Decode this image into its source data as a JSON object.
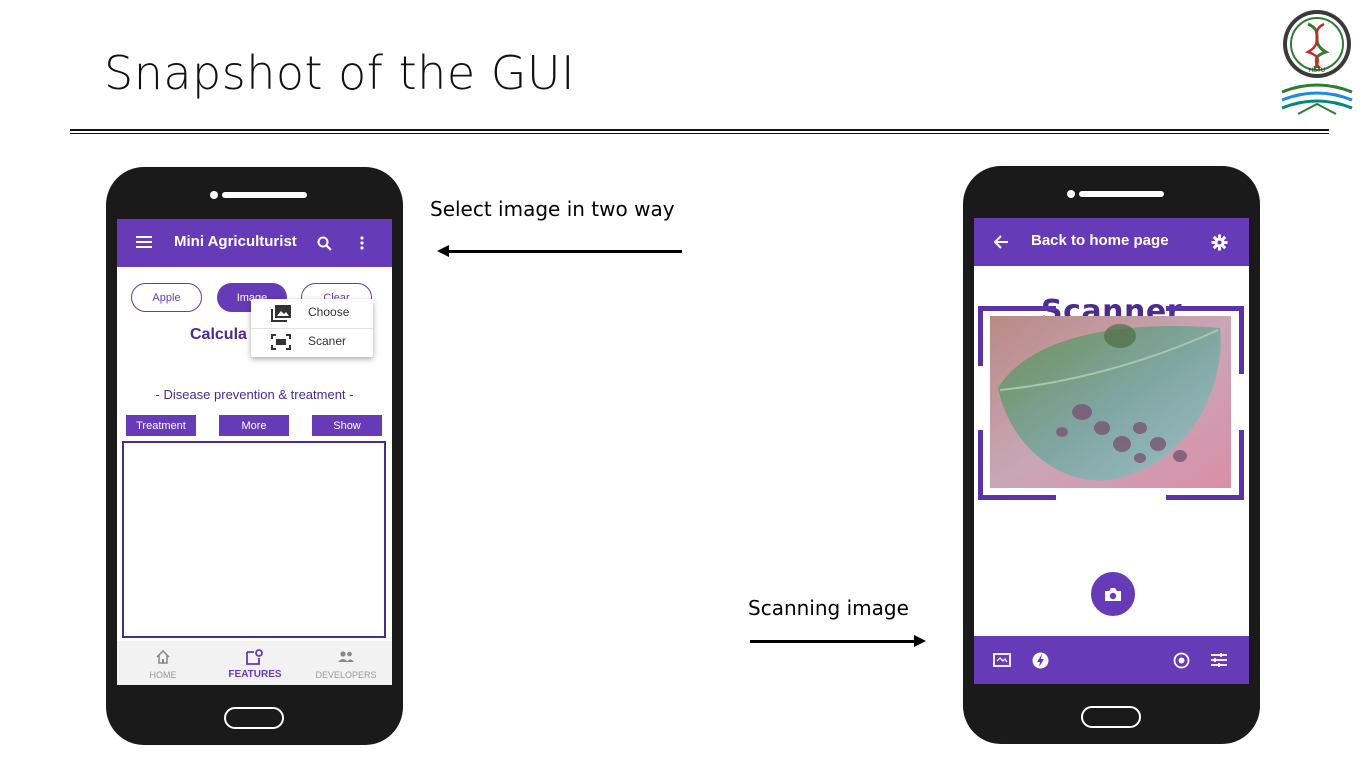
{
  "slide": {
    "title": "Snapshot of the GUI",
    "caption_select": "Select image in two way",
    "caption_scan": "Scanning image"
  },
  "logo": {
    "text": "HSTU",
    "ring_text": "Hajee Mohammad Danesh Science & Technology University"
  },
  "left_phone": {
    "appbar": {
      "title": "Mini Agriculturist",
      "icons": [
        "menu-icon",
        "search-icon",
        "more-vert-icon"
      ]
    },
    "chips": [
      {
        "label": "Apple",
        "style": "outline"
      },
      {
        "label": "Image",
        "style": "filled"
      },
      {
        "label": "Clear",
        "style": "outline"
      }
    ],
    "calc_title": "Calcula",
    "menu": [
      {
        "label": "Choose",
        "icon": "photo-library-icon"
      },
      {
        "label": "Scaner",
        "icon": "scanner-icon"
      }
    ],
    "disease_heading": "- Disease prevention & treatment -",
    "buttons": [
      "Treatment",
      "More",
      "Show"
    ],
    "bottom_nav": [
      {
        "label": "HOME",
        "icon": "home-icon",
        "active": false
      },
      {
        "label": "FEATURES",
        "icon": "features-icon",
        "active": true
      },
      {
        "label": "DEVELOPERS",
        "icon": "developers-icon",
        "active": false
      }
    ]
  },
  "right_phone": {
    "appbar": {
      "title": "Back to home page",
      "icons": [
        "back-arrow-icon",
        "settings-icon"
      ]
    },
    "scanner_title": "Scanner",
    "image": "leaf-with-disease-spots",
    "toolbar_icons": [
      "aspect-ratio-icon",
      "flash-icon",
      "camera-icon",
      "focus-icon",
      "tune-icon"
    ]
  },
  "colors": {
    "primary": "#673ab7",
    "primary_dark": "#4a2b8f",
    "phone_body": "#1a1a1a"
  }
}
